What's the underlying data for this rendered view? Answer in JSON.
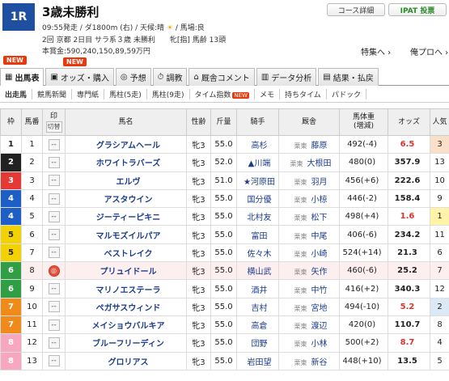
{
  "race": {
    "number": "1R",
    "title": "3歳未勝利",
    "info1_start": "09:55発走 / ダ1800m (右) / 天候:晴",
    "info1_going": "/ 馬場:良",
    "info2": "2回 京都 2日目 サラ系３歳 未勝利　　牝[指] 馬齢 13頭",
    "info3": "本賞金:590,240,150,89,59万円"
  },
  "buttons": {
    "course": "コース詳細",
    "ipat": "IPAT 投票"
  },
  "links": {
    "tokushu": "特集へ ›",
    "ore": "俺プロへ ›"
  },
  "badges": {
    "new1": "NEW",
    "new2": "NEW"
  },
  "tabs": [
    {
      "label": "出馬表",
      "icon": "▦"
    },
    {
      "label": "オッズ・購入",
      "icon": "▣"
    },
    {
      "label": "予想",
      "icon": "◎"
    },
    {
      "label": "調教",
      "icon": "⏱"
    },
    {
      "label": "厩舎コメント",
      "icon": "⌂"
    },
    {
      "label": "データ分析",
      "icon": "▥"
    },
    {
      "label": "結果・払戻",
      "icon": "▤"
    }
  ],
  "subtabs": [
    "出走馬",
    "競馬新聞",
    "専門紙",
    "馬柱(5走)",
    "馬柱(9走)",
    "タイム指数",
    "メモ",
    "持ちタイム",
    "パドック"
  ],
  "subtab_new": "NEW",
  "headers": {
    "waku": "枠",
    "umaban": "馬番",
    "mark": "印",
    "mark_sub": "切替",
    "horse": "馬名",
    "sexage": "性齢",
    "kinryo": "斤量",
    "jockey": "騎手",
    "trainer": "厩舎",
    "bataiju": "馬体重",
    "bataiju_sub": "(増減)",
    "odds": "オッズ",
    "pop": "人気"
  },
  "colors": {
    "waku": [
      "#ffffff",
      "#222222",
      "#e53935",
      "#1e5fc7",
      "#f2d200",
      "#2f9e44",
      "#f08a1a",
      "#f7a7c0"
    ],
    "waku_text": [
      "#222222",
      "#ffffff",
      "#ffffff",
      "#ffffff",
      "#222222",
      "#ffffff",
      "#ffffff",
      "#ffffff"
    ]
  },
  "entries": [
    {
      "waku": "1",
      "umaban": "1",
      "mark": "--",
      "horse": "グラシアムヘール",
      "sexage": "牝3",
      "kinryo": "55.0",
      "jockey": "高杉",
      "region": "栗東",
      "trainer": "藤原",
      "weight": "492(-4)",
      "odds": "6.5",
      "pop": "3"
    },
    {
      "waku": "2",
      "umaban": "2",
      "mark": "--",
      "horse": "ホワイトラバーズ",
      "sexage": "牝3",
      "kinryo": "52.0",
      "jockey": "▲川端",
      "region": "栗東",
      "trainer": "大根田",
      "weight": "480(0)",
      "odds": "357.9",
      "pop": "13"
    },
    {
      "waku": "3",
      "umaban": "3",
      "mark": "--",
      "horse": "エルヴ",
      "sexage": "牝3",
      "kinryo": "51.0",
      "jockey": "★河原田",
      "region": "栗東",
      "trainer": "羽月",
      "weight": "456(+6)",
      "odds": "222.6",
      "pop": "10"
    },
    {
      "waku": "4",
      "umaban": "4",
      "mark": "--",
      "horse": "アスタウイン",
      "sexage": "牝3",
      "kinryo": "55.0",
      "jockey": "国分優",
      "region": "栗東",
      "trainer": "小椋",
      "weight": "446(-2)",
      "odds": "158.4",
      "pop": "9"
    },
    {
      "waku": "4",
      "umaban": "5",
      "mark": "--",
      "horse": "ジーティーピキニ",
      "sexage": "牝3",
      "kinryo": "55.0",
      "jockey": "北村友",
      "region": "栗東",
      "trainer": "松下",
      "weight": "498(+4)",
      "odds": "1.6",
      "pop": "1"
    },
    {
      "waku": "5",
      "umaban": "6",
      "mark": "--",
      "horse": "マルモズイルパア",
      "sexage": "牝3",
      "kinryo": "55.0",
      "jockey": "富田",
      "region": "栗東",
      "trainer": "中尾",
      "weight": "406(-6)",
      "odds": "234.2",
      "pop": "11"
    },
    {
      "waku": "5",
      "umaban": "7",
      "mark": "--",
      "horse": "ベストレイク",
      "sexage": "牝3",
      "kinryo": "55.0",
      "jockey": "佐々木",
      "region": "栗東",
      "trainer": "小崎",
      "weight": "524(+14)",
      "odds": "21.3",
      "pop": "6"
    },
    {
      "waku": "6",
      "umaban": "8",
      "mark": "◎",
      "horse": "プリュイドール",
      "sexage": "牝3",
      "kinryo": "55.0",
      "jockey": "横山武",
      "region": "栗東",
      "trainer": "矢作",
      "weight": "460(-6)",
      "odds": "25.2",
      "pop": "7"
    },
    {
      "waku": "6",
      "umaban": "9",
      "mark": "--",
      "horse": "マリノエステーラ",
      "sexage": "牝3",
      "kinryo": "55.0",
      "jockey": "酒井",
      "region": "栗東",
      "trainer": "中竹",
      "weight": "416(+2)",
      "odds": "340.3",
      "pop": "12"
    },
    {
      "waku": "7",
      "umaban": "10",
      "mark": "--",
      "horse": "ペガサスウィンド",
      "sexage": "牝3",
      "kinryo": "55.0",
      "jockey": "吉村",
      "region": "栗東",
      "trainer": "宮地",
      "weight": "494(-10)",
      "odds": "5.2",
      "pop": "2"
    },
    {
      "waku": "7",
      "umaban": "11",
      "mark": "--",
      "horse": "メイショウバルキア",
      "sexage": "牝3",
      "kinryo": "55.0",
      "jockey": "高倉",
      "region": "栗東",
      "trainer": "渡辺",
      "weight": "420(0)",
      "odds": "110.7",
      "pop": "8"
    },
    {
      "waku": "8",
      "umaban": "12",
      "mark": "--",
      "horse": "ブルーフリーディン",
      "sexage": "牝3",
      "kinryo": "55.0",
      "jockey": "団野",
      "region": "栗東",
      "trainer": "小林",
      "weight": "500(+2)",
      "odds": "8.7",
      "pop": "4"
    },
    {
      "waku": "8",
      "umaban": "13",
      "mark": "--",
      "horse": "グロリアス",
      "sexage": "牝3",
      "kinryo": "55.0",
      "jockey": "岩田望",
      "region": "栗東",
      "trainer": "新谷",
      "weight": "448(+10)",
      "odds": "13.5",
      "pop": "5"
    }
  ]
}
